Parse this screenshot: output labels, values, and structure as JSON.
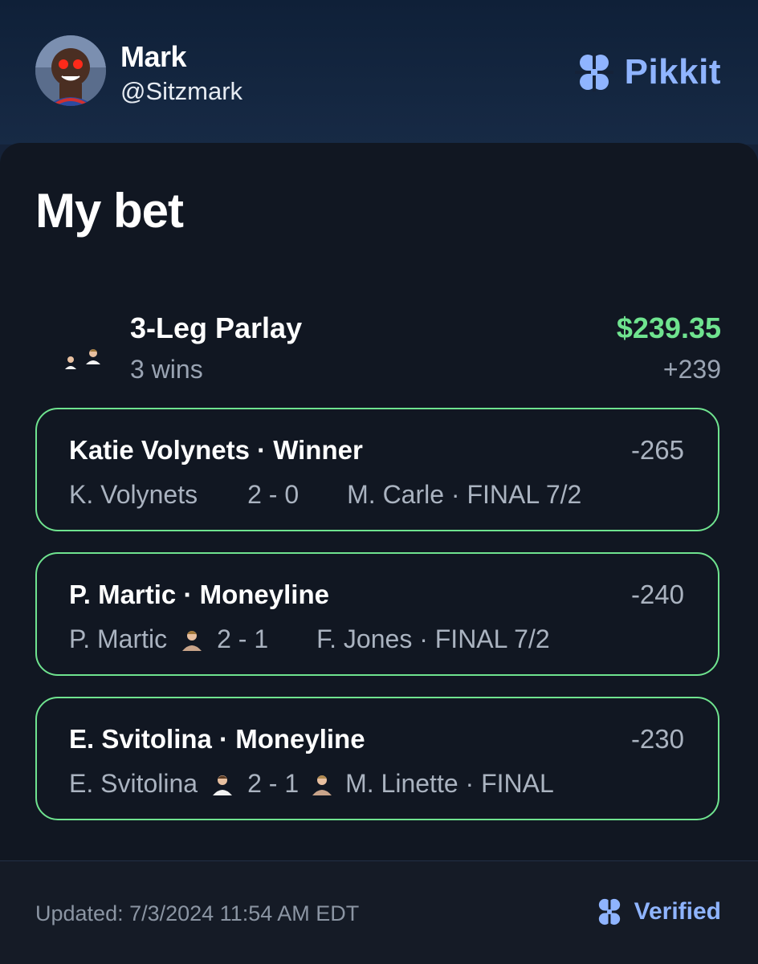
{
  "header": {
    "user_name": "Mark",
    "user_handle": "@Sitzmark",
    "brand_name": "Pikkit",
    "brand_icon": "clover-icon",
    "brand_color": "#8fb4ff"
  },
  "card": {
    "title": "My bet"
  },
  "parlay": {
    "title": "3-Leg Parlay",
    "subtitle": "3 wins",
    "amount": "$239.35",
    "odds": "+239",
    "amount_color": "#6fe38f"
  },
  "legs": [
    {
      "title": "Katie Volynets · Winner",
      "odds": "-265",
      "player": "K. Volynets",
      "score": "2 - 0",
      "opponent": "M. Carle · FINAL 7/2"
    },
    {
      "title": "P. Martic · Moneyline",
      "odds": "-240",
      "player": "P. Martic",
      "score": "2 - 1",
      "opponent": "F. Jones · FINAL 7/2"
    },
    {
      "title": "E. Svitolina · Moneyline",
      "odds": "-230",
      "player": "E. Svitolina",
      "score": "2 - 1",
      "opponent": "M. Linette · FINAL"
    }
  ],
  "footer": {
    "updated": "Updated: 7/3/2024 11:54 AM EDT",
    "verified": "Verified",
    "verified_icon": "clover-icon"
  },
  "colors": {
    "win_border": "#6fe38f",
    "background": "#111722",
    "header_bg": "#152238"
  }
}
